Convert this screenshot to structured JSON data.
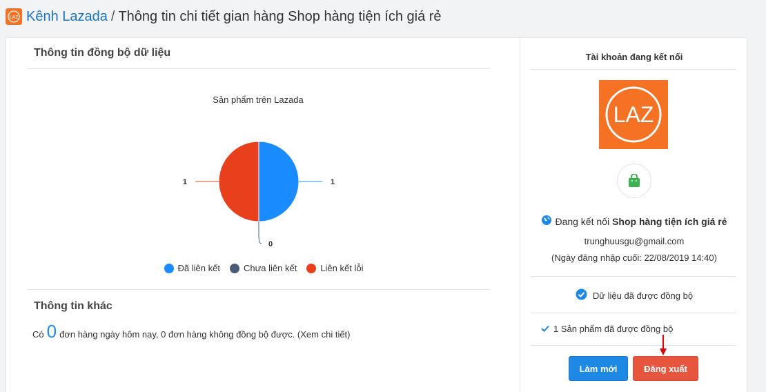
{
  "breadcrumb": {
    "channel": "Kênh Lazada",
    "separator": "/",
    "page": "Thông tin chi tiết gian hàng Shop hàng tiện ích giá rẻ"
  },
  "sync_section": {
    "title": "Thông tin đồng bộ dữ liệu"
  },
  "chart_data": {
    "type": "pie",
    "title": "Sản phẩm trên Lazada",
    "categories": [
      "Đã liên kết",
      "Chưa liên kết",
      "Liên kết lỗi"
    ],
    "values": [
      1,
      0,
      1
    ],
    "colors": [
      "#1a8cff",
      "#4a5b78",
      "#e8401c"
    ],
    "legend_position": "bottom"
  },
  "other_section": {
    "title": "Thông tin khác",
    "prefix": "Có",
    "count": "0",
    "suffix": "đơn hàng ngày hôm nay, 0 đơn hàng không đồng bộ được. (Xem chi tiết)"
  },
  "account": {
    "title": "Tài khoản đang kết nối",
    "logo_text": "LAZ",
    "connected_prefix": "Đang kết nối",
    "shop_name": "Shop hàng tiện ích giá rẻ",
    "email": "trunghuusgu@gmail.com",
    "last_login": "(Ngày đăng nhập cuối: 22/08/2019 14:40)",
    "data_synced": "Dữ liệu đã được đồng bộ",
    "products_synced": "1 Sản phẩm đã được đồng bộ",
    "refresh_label": "Làm mới",
    "logout_label": "Đăng xuất"
  },
  "icons": {
    "globe": "globe-icon",
    "shop": "shopping-bag-icon",
    "check_circle": "check-circle-icon",
    "check": "checkmark-icon"
  }
}
